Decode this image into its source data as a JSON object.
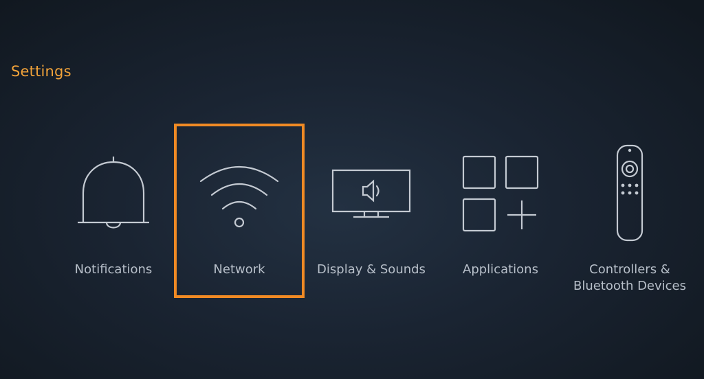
{
  "header": {
    "title": "Settings"
  },
  "menu": {
    "items": [
      {
        "label_lines": [
          "Notifications"
        ],
        "icon": "bell-icon"
      },
      {
        "label_lines": [
          "Network"
        ],
        "icon": "wifi-icon"
      },
      {
        "label_lines": [
          "Display & Sounds"
        ],
        "icon": "display-sound-icon"
      },
      {
        "label_lines": [
          "Applications"
        ],
        "icon": "apps-grid-icon"
      },
      {
        "label_lines": [
          "Controllers &",
          "Bluetooth Devices"
        ],
        "icon": "remote-control-icon"
      }
    ],
    "focused_index": 1
  },
  "colors": {
    "accent": "#f08a24",
    "title": "#f2a33a",
    "label": "#b7bfc9",
    "icon_stroke": "#c4cad2"
  }
}
